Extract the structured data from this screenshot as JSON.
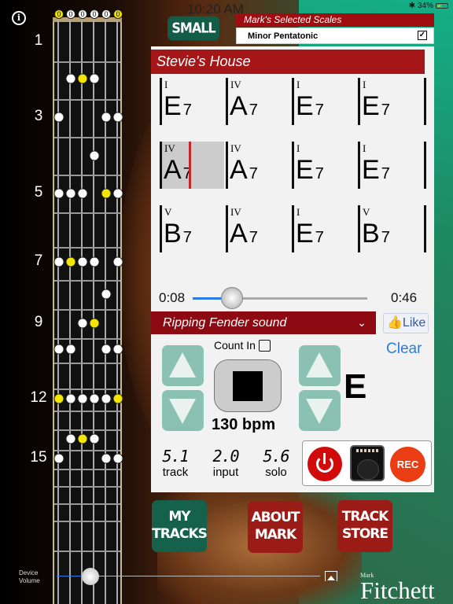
{
  "status_bar": {
    "time": "10:20 AM",
    "bluetooth_icon": "bluetooth-icon",
    "battery": "34%"
  },
  "fretboard": {
    "open_strings": [
      {
        "label": "0",
        "root": true
      },
      {
        "label": "0",
        "root": false
      },
      {
        "label": "0",
        "root": false
      },
      {
        "label": "0",
        "root": false
      },
      {
        "label": "0",
        "root": false
      },
      {
        "label": "0",
        "root": true
      }
    ],
    "fret_markers": [
      "1",
      "3",
      "5",
      "7",
      "9",
      "12",
      "15"
    ],
    "scale_dots": [
      {
        "fret": 2,
        "string": 2
      },
      {
        "fret": 2,
        "string": 3,
        "root": true
      },
      {
        "fret": 2,
        "string": 4
      },
      {
        "fret": 3,
        "string": 1
      },
      {
        "fret": 3,
        "string": 5
      },
      {
        "fret": 3,
        "string": 6
      },
      {
        "fret": 4,
        "string": 4
      },
      {
        "fret": 5,
        "string": 1
      },
      {
        "fret": 5,
        "string": 2
      },
      {
        "fret": 5,
        "string": 3
      },
      {
        "fret": 5,
        "string": 5,
        "root": true
      },
      {
        "fret": 5,
        "string": 6
      },
      {
        "fret": 7,
        "string": 1
      },
      {
        "fret": 7,
        "string": 2,
        "root": true
      },
      {
        "fret": 7,
        "string": 3
      },
      {
        "fret": 7,
        "string": 4
      },
      {
        "fret": 7,
        "string": 6
      },
      {
        "fret": 8,
        "string": 5
      },
      {
        "fret": 9,
        "string": 3
      },
      {
        "fret": 9,
        "string": 4,
        "root": true
      },
      {
        "fret": 10,
        "string": 1
      },
      {
        "fret": 10,
        "string": 2
      },
      {
        "fret": 10,
        "string": 5
      },
      {
        "fret": 10,
        "string": 6
      },
      {
        "fret": 12,
        "string": 1,
        "root": true
      },
      {
        "fret": 12,
        "string": 2
      },
      {
        "fret": 12,
        "string": 3
      },
      {
        "fret": 12,
        "string": 4
      },
      {
        "fret": 12,
        "string": 5
      },
      {
        "fret": 12,
        "string": 6,
        "root": true
      },
      {
        "fret": 14,
        "string": 2
      },
      {
        "fret": 14,
        "string": 3,
        "root": true
      },
      {
        "fret": 14,
        "string": 4
      },
      {
        "fret": 15,
        "string": 1
      },
      {
        "fret": 15,
        "string": 5
      },
      {
        "fret": 15,
        "string": 6
      }
    ]
  },
  "size_button": "SMALL",
  "scales": {
    "header": "Mark's Selected Scales",
    "selected": "Minor Pentatonic",
    "checked": true,
    "check_mark": "✓"
  },
  "song": {
    "title": "Stevie's House",
    "bars": [
      {
        "num": "I",
        "chord": "E",
        "ext": "7"
      },
      {
        "num": "IV",
        "chord": "A",
        "ext": "7"
      },
      {
        "num": "I",
        "chord": "E",
        "ext": "7"
      },
      {
        "num": "I",
        "chord": "E",
        "ext": "7"
      },
      {
        "num": "IV",
        "chord": "A",
        "ext": "7",
        "active": true
      },
      {
        "num": "IV",
        "chord": "A",
        "ext": "7"
      },
      {
        "num": "I",
        "chord": "E",
        "ext": "7"
      },
      {
        "num": "I",
        "chord": "E",
        "ext": "7"
      },
      {
        "num": "V",
        "chord": "B",
        "ext": "7"
      },
      {
        "num": "IV",
        "chord": "A",
        "ext": "7"
      },
      {
        "num": "I",
        "chord": "E",
        "ext": "7"
      },
      {
        "num": "V",
        "chord": "B",
        "ext": "7"
      }
    ]
  },
  "player": {
    "elapsed": "0:08",
    "total": "0:46",
    "progress": 0.17
  },
  "sound": {
    "label": "Ripping Fender sound",
    "chevron": "⌄"
  },
  "like": {
    "label": "Like",
    "icon": "👍"
  },
  "controls": {
    "count_in": "Count In",
    "clear": "Clear",
    "bpm": "130 bpm",
    "key": "E",
    "stats": [
      {
        "value": "5.1",
        "label": "track"
      },
      {
        "value": "2.0",
        "label": "input"
      },
      {
        "value": "5.6",
        "label": "solo"
      }
    ],
    "rec": "REC"
  },
  "nav": [
    {
      "label": "MY\nTRACKS",
      "color": "#15614b"
    },
    {
      "label": "ABOUT\nMARK",
      "color": "#9b1c17"
    },
    {
      "label": "TRACK\nSTORE",
      "color": "#9b1c17"
    }
  ],
  "volume": {
    "label": "Device\nVolume",
    "level": 0.13
  },
  "brand": {
    "first": "Mark",
    "last": "Fitchett"
  }
}
